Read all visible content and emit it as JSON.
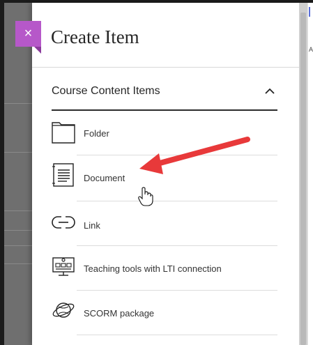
{
  "panel": {
    "title": "Create Item",
    "close_symbol": "×"
  },
  "section": {
    "title": "Course Content Items",
    "expanded": true,
    "items": [
      {
        "label": "Folder",
        "icon": "folder-icon"
      },
      {
        "label": "Document",
        "icon": "document-icon"
      },
      {
        "label": "Link",
        "icon": "link-icon"
      },
      {
        "label": "Teaching tools with LTI connection",
        "icon": "lti-icon"
      },
      {
        "label": "SCORM package",
        "icon": "scorm-icon"
      }
    ]
  },
  "background": {
    "right_letter": "A"
  },
  "colors": {
    "close_button": "#b658c9",
    "annotation_arrow": "#e8393a",
    "text": "#333333"
  }
}
